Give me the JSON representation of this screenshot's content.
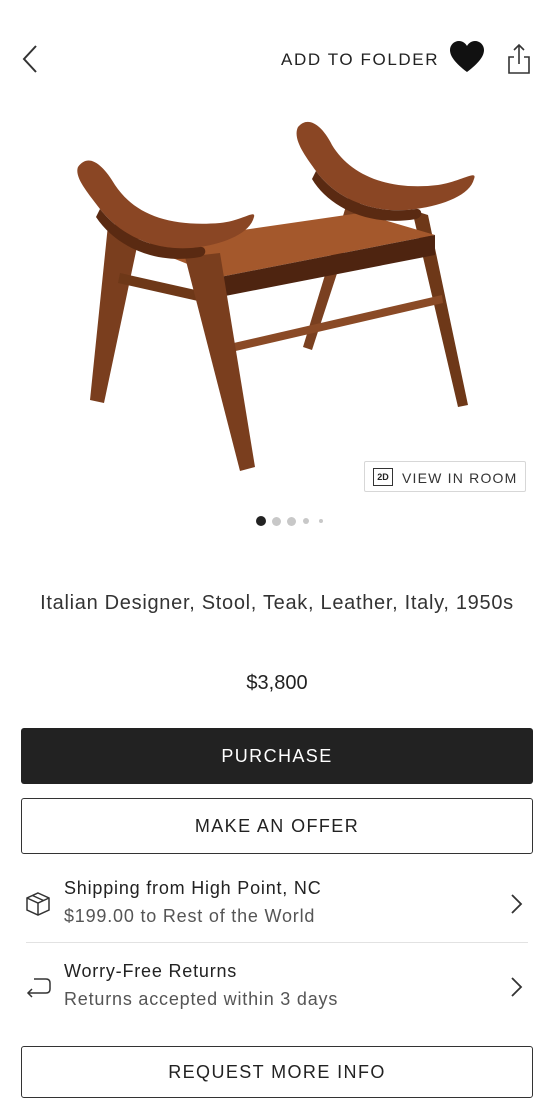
{
  "header": {
    "back_icon": "chevron-left-icon",
    "add_to_folder_label": "ADD TO FOLDER",
    "heart_icon": "heart-icon",
    "share_icon": "share-icon"
  },
  "gallery": {
    "image_subject": "wooden stool",
    "view_in_room_badge": "2D",
    "view_in_room_label": "VIEW IN ROOM",
    "active_slide_index": 0
  },
  "product": {
    "title": "Italian Designer, Stool, Teak, Leather, Italy, 1950s",
    "price": "$3,800"
  },
  "actions": {
    "purchase_label": "PURCHASE",
    "offer_label": "MAKE AN OFFER",
    "request_info_label": "REQUEST MORE INFO"
  },
  "shipping": {
    "icon": "package-icon",
    "title": "Shipping from High Point, NC",
    "detail": "$199.00 to Rest of the World"
  },
  "returns": {
    "icon": "return-arrow-icon",
    "title": "Worry-Free Returns",
    "detail": "Returns accepted within 3 days"
  },
  "colors": {
    "primary_button": "#222222",
    "wood": "#7a3e1e"
  }
}
